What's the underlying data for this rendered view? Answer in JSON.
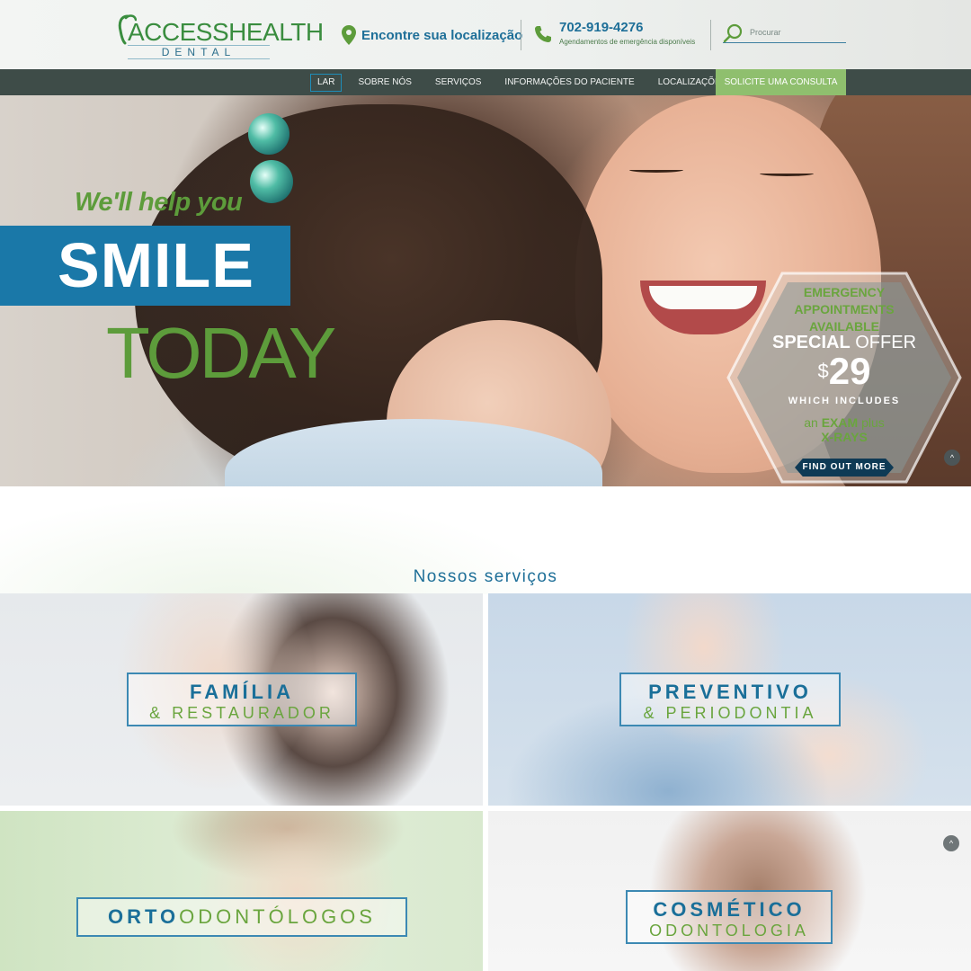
{
  "header": {
    "logo": {
      "access": "ACCESS",
      "health": "HEALTH",
      "dental": "DENTAL"
    },
    "location_label": "Encontre sua localização",
    "phone_number": "702-919-4276",
    "phone_sub": "Agendamentos de emergência disponíveis",
    "search_placeholder": "Procurar"
  },
  "nav": {
    "items": [
      {
        "label": "LAR",
        "active": true
      },
      {
        "label": "SOBRE NÓS"
      },
      {
        "label": "SERVIÇOS"
      },
      {
        "label": "INFORMAÇÕES DO PACIENTE"
      },
      {
        "label": "LOCALIZAÇÕES"
      }
    ],
    "cta": "SOLICITE UMA CONSULTA"
  },
  "hero": {
    "tagline": "We'll help you",
    "smile": "SMILE",
    "today": "TODAY",
    "offer": {
      "line1": "EMERGENCY",
      "line2": "APPOINTMENTS",
      "line3": "AVAILABLE",
      "special_bold": "SPECIAL",
      "special_rest": "OFFER",
      "currency": "$",
      "price": "29",
      "includes": "WHICH INCLUDES",
      "exam_prefix": "an",
      "exam_bold": "EXAM",
      "exam_suffix": "plus",
      "xrays": "X-RAYS",
      "button": "FIND OUT MORE"
    }
  },
  "services": {
    "title": "Nossos serviços",
    "tiles": [
      {
        "line1": "FAMÍLIA",
        "line2": "& RESTAURADOR"
      },
      {
        "line1": "PREVENTIVO",
        "line2": "& PERIODONTIA"
      },
      {
        "line1": "ORTO",
        "line2": "ODONTÓLOGOS"
      },
      {
        "line1": "COSMÉTICO",
        "line2": "ODONTOLOGIA"
      }
    ]
  },
  "colors": {
    "brand_blue": "#1e6f98",
    "brand_green": "#5d9c3b",
    "nav_bg": "#3e4c48",
    "cta_green": "#8fbf6e"
  },
  "icons": {
    "location": "map-pin-icon",
    "phone": "phone-icon",
    "search": "search-icon",
    "scroll_top": "chevron-up-icon"
  }
}
